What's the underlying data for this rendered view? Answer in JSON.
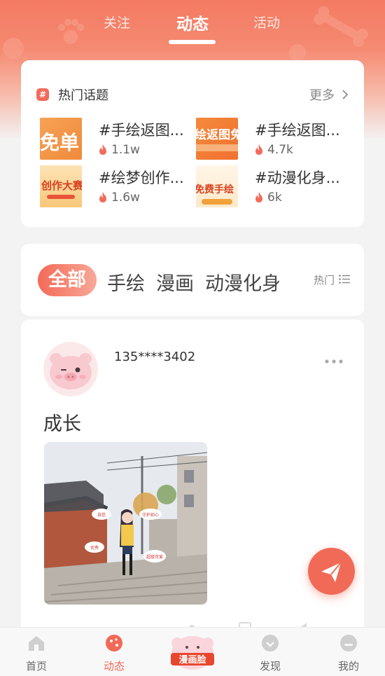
{
  "top_tabs": [
    {
      "label": "关注"
    },
    {
      "label": "动态"
    },
    {
      "label": "活动"
    }
  ],
  "hot_topics": {
    "title": "热门话题",
    "more_label": "更多",
    "items": [
      {
        "name": "#手绘返图...",
        "heat": "1.1w",
        "thumb_text": "免单"
      },
      {
        "name": "#手绘返图...",
        "heat": "4.7k",
        "thumb_text": "绘返图免"
      },
      {
        "name": "#绘梦创作...",
        "heat": "1.6w",
        "thumb_text": "创作大赛"
      },
      {
        "name": "#动漫化身...",
        "heat": "6k",
        "thumb_text": "免费手绘"
      }
    ]
  },
  "categories": {
    "items": [
      "全部",
      "手绘",
      "漫画",
      "动漫化身"
    ],
    "sort_label": "热门"
  },
  "post": {
    "username": "135****3402",
    "text": "成长",
    "bubbles": [
      "自信",
      "守护初心",
      "优秀",
      "超级可爱"
    ]
  },
  "bottom_nav": [
    {
      "label": "首页"
    },
    {
      "label": "动态"
    },
    {
      "label": "漫画脸"
    },
    {
      "label": "发现"
    },
    {
      "label": "我的"
    }
  ],
  "colors": {
    "accent": "#f16a58",
    "header_top": "#f47a62"
  }
}
